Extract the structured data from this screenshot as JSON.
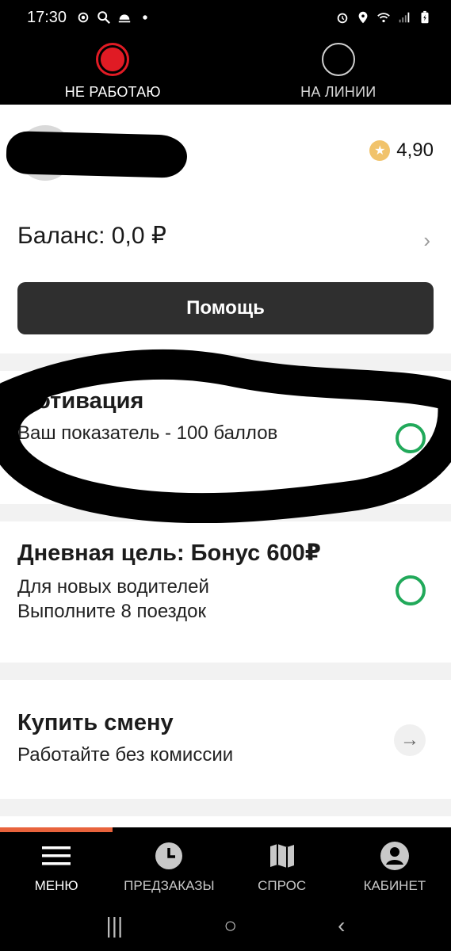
{
  "statusbar": {
    "time": "17:30",
    "left_icons": [
      "location-target-icon",
      "search-icon",
      "weather-icon",
      "dot-icon"
    ],
    "right_icons": [
      "alarm-icon",
      "location-pin-icon",
      "wifi-icon",
      "signal-icon",
      "battery-icon"
    ]
  },
  "work_state": {
    "off_label": "НЕ РАБОТАЮ",
    "on_label": "НА ЛИНИИ",
    "active": "off",
    "off_color": "#e01b24"
  },
  "profile": {
    "rating": "4,90",
    "balance": "Баланс: 0,0  ₽",
    "help_button": "Помощь"
  },
  "motivation": {
    "title": "Мотивация",
    "subtitle": "Ваш показатель - 100 баллов"
  },
  "daily_goal": {
    "title": "Дневная цель: Бонус 600₽",
    "line1": "Для новых водителей",
    "line2": "Выполните 8 поездок",
    "accent": "#21a95a"
  },
  "buy_shift": {
    "title": "Купить смену",
    "subtitle": "Работайте без комиссии"
  },
  "bottom_nav": {
    "items": [
      {
        "label": "МЕНЮ",
        "icon": "menu-icon"
      },
      {
        "label": "ПРЕДЗАКАЗЫ",
        "icon": "clock-icon"
      },
      {
        "label": "СПРОС",
        "icon": "map-icon"
      },
      {
        "label": "КАБИНЕТ",
        "icon": "account-icon"
      }
    ],
    "active_index": 0,
    "accent": "#e8633c"
  },
  "system_nav": {
    "recent": "|||",
    "home": "○",
    "back": "‹"
  }
}
